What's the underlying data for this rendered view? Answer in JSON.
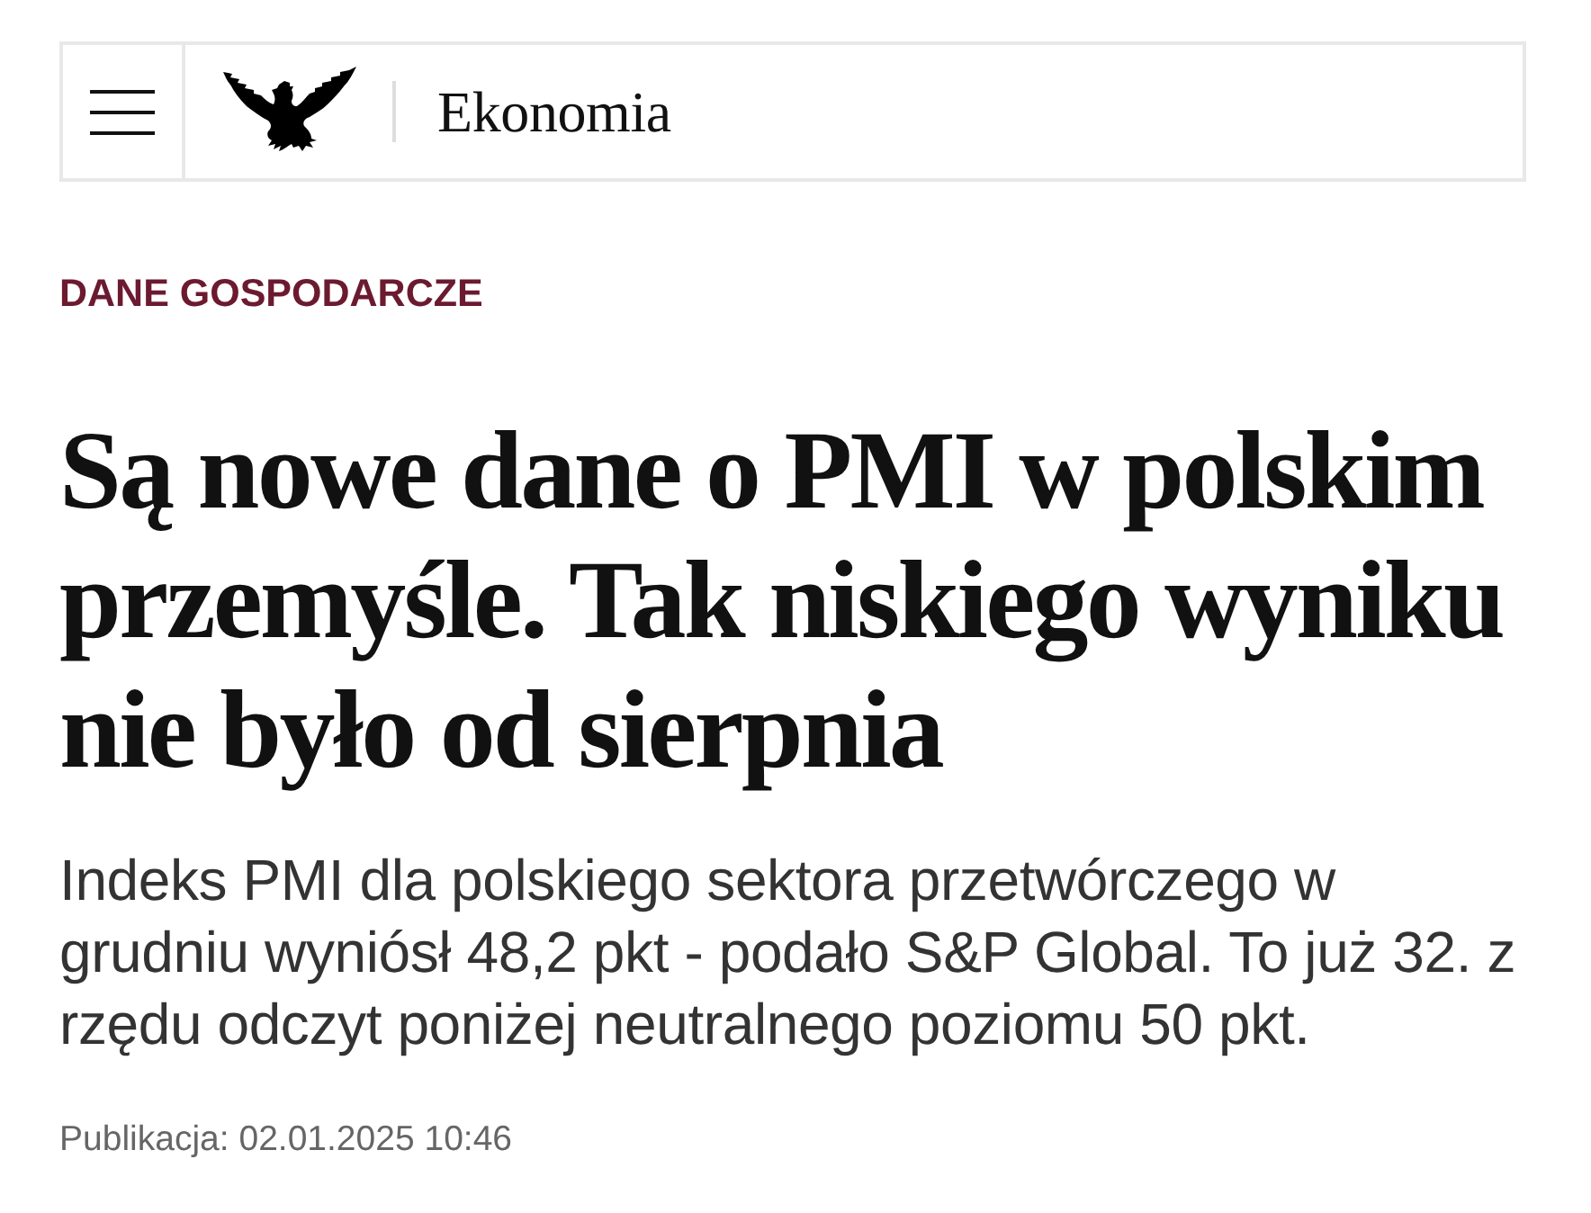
{
  "header": {
    "section_title": "Ekonomia"
  },
  "article": {
    "category": "DANE GOSPODARCZE",
    "title": "Są nowe dane o PMI w polskim przemyśle. Tak niskiego wyniku nie było od sierpnia",
    "lead": "Indeks PMI dla polskiego sektora przetwórczego w grudniu wyniósł 48,2 pkt - podało S&P Global. To już 32. z rzędu odczyt poniżej neutralnego poziomu 50 pkt.",
    "published": "Publikacja: 02.01.2025 10:46"
  }
}
